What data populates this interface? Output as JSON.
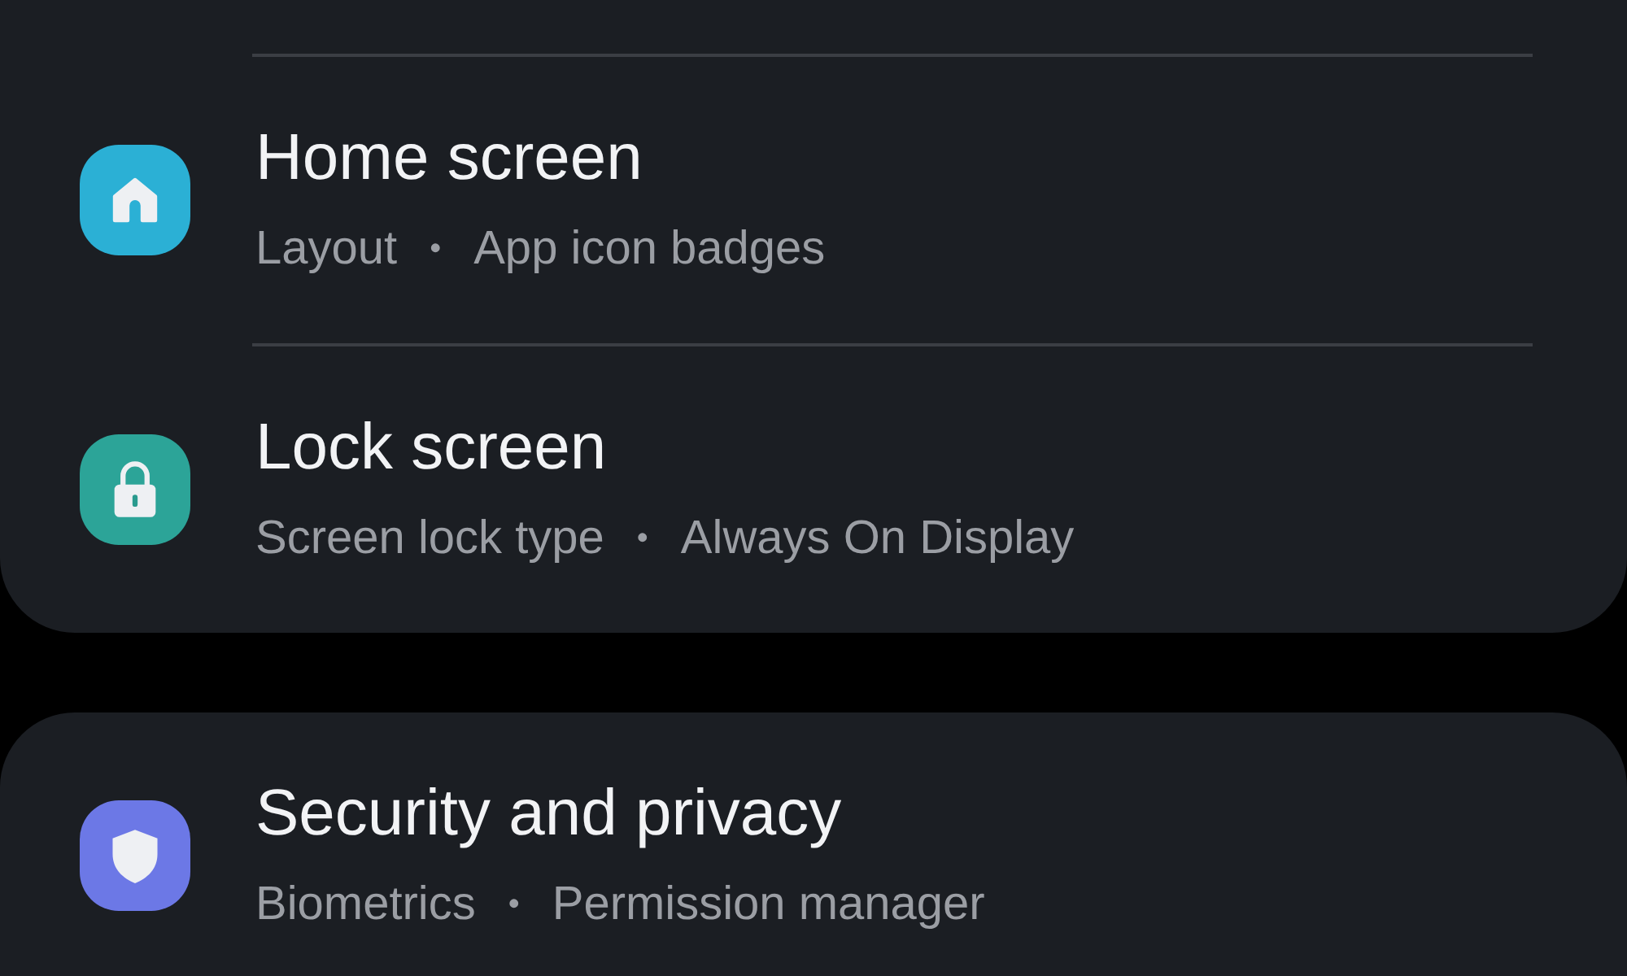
{
  "groups": [
    {
      "items": [
        {
          "kind": "home",
          "color": "#2bb0d5",
          "title": "Home screen",
          "subtitle": [
            "Layout",
            "•",
            "App icon badges"
          ]
        },
        {
          "kind": "lock",
          "color": "#2ca498",
          "title": "Lock screen",
          "subtitle": [
            "Screen lock type",
            "•",
            "Always On Display"
          ]
        }
      ]
    },
    {
      "items": [
        {
          "kind": "shield",
          "color": "#6c78e6",
          "title": "Security and privacy",
          "subtitle": [
            "Biometrics",
            "•",
            "Permission manager"
          ]
        }
      ]
    }
  ]
}
